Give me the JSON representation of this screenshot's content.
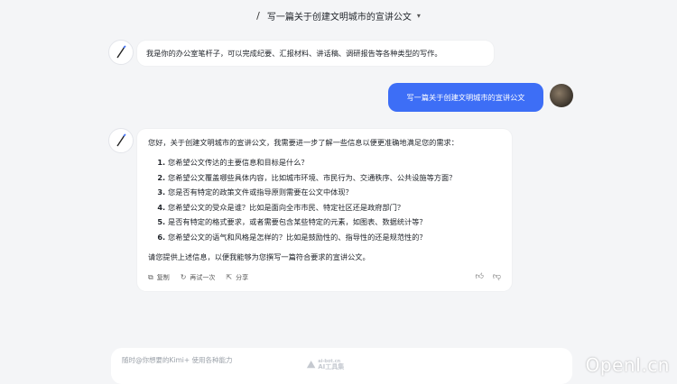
{
  "header": {
    "title": "写一篇关于创建文明城市的宣讲公文",
    "icon": "pen-icon",
    "dropdown_icon": "chevron-down-icon"
  },
  "messages": {
    "bot_intro": "我是你的办公室笔杆子，可以完成纪要、汇报材料、讲话稿、调研报告等各种类型的写作。",
    "user_prompt": "写一篇关于创建文明城市的宣讲公文",
    "bot_reply": {
      "intro": "您好，关于创建文明城市的宣讲公文，我需要进一步了解一些信息以便更准确地满足您的需求：",
      "questions": [
        "您希望公文传达的主要信息和目标是什么？",
        "您希望公文覆盖哪些具体内容，比如城市环境、市民行为、交通秩序、公共设施等方面？",
        "您是否有特定的政策文件或指导原则需要在公文中体现？",
        "您希望公文的受众是谁？比如是面向全市市民、特定社区还是政府部门？",
        "是否有特定的格式要求，或者需要包含某些特定的元素，如图表、数据统计等？",
        "您希望公文的语气和风格是怎样的？比如是鼓励性的、指导性的还是规范性的？"
      ],
      "outro": "请您提供上述信息，以便我能够为您撰写一篇符合要求的宣讲公文。"
    }
  },
  "actions": {
    "copy": "复制",
    "retry": "再试一次",
    "share": "分享"
  },
  "composer": {
    "placeholder": "随时@你想要的Kimi+ 使用各种能力"
  },
  "watermarks": {
    "center": "AI工具集",
    "center_small": "ai-bot.cn",
    "corner": "OpenI.cn"
  },
  "colors": {
    "accent": "#3d6ef6",
    "background": "#f4f5f7"
  }
}
